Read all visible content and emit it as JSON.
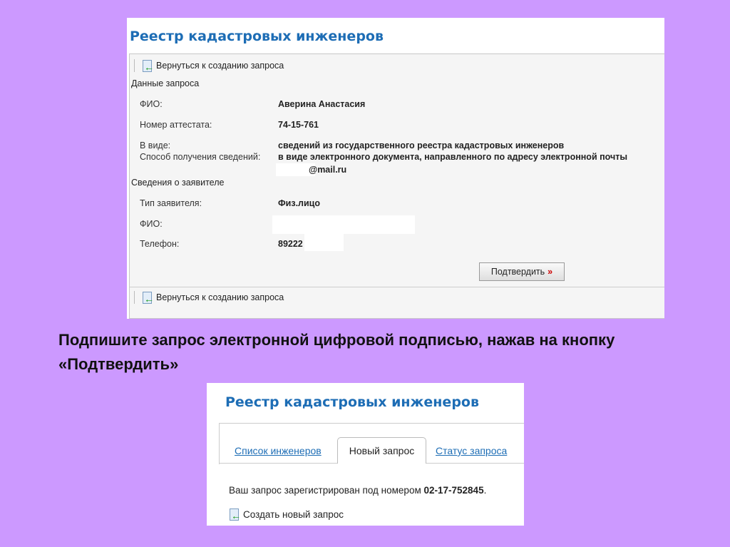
{
  "top_screen": {
    "title": "Реестр кадастровых инженеров",
    "back_link": "Вернуться к созданию запроса",
    "request_section": "Данные запроса",
    "fields": [
      {
        "label": "ФИО:",
        "value": "Аверина Анастасия"
      },
      {
        "label": "Номер аттестата:",
        "value": "74-15-761"
      },
      {
        "label": "В виде:",
        "value": "сведений из государственного реестра кадастровых инженеров"
      },
      {
        "label": "Способ получения сведений:",
        "value": "в виде электронного документа, направленного по адресу электронной почты"
      }
    ],
    "email_partial": "@mail.ru",
    "applicant_section": "Сведения о заявителе",
    "applicant_fields": [
      {
        "label": "Тип заявителя:",
        "value": "Физ.лицо"
      },
      {
        "label": "ФИО:",
        "value": ""
      },
      {
        "label": "Телефон:",
        "value": "89222"
      }
    ],
    "confirm_button": "Подтвердить",
    "confirm_arrow": "»"
  },
  "caption": "Подпишите запрос электронной цифровой подписью, нажав на кнопку «Подтвердить»",
  "bottom_screen": {
    "title": "Реестр кадастровых инженеров",
    "tabs": [
      "Список инженеров",
      "Новый запрос",
      "Статус запроса"
    ],
    "message": "Ваш запрос зарегистрирован под номером",
    "request_number": "02-17-752845",
    "period": ".",
    "new_request_link": "Создать новый запрос"
  }
}
